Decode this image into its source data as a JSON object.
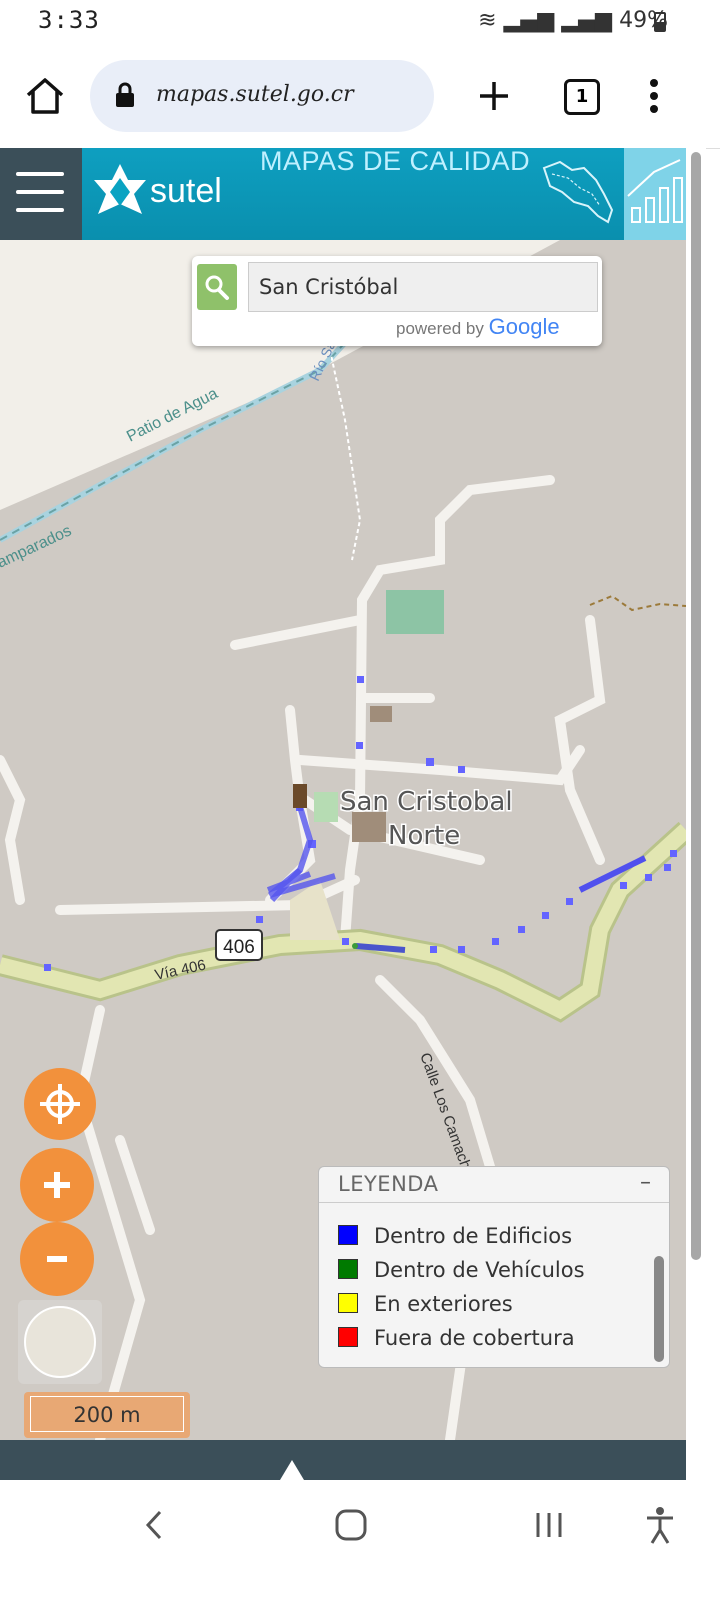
{
  "status_bar": {
    "time": "3:33",
    "battery": "49%"
  },
  "browser": {
    "url": "mapas.sutel.go.cr",
    "tab_count": "1"
  },
  "header": {
    "brand": "sutel",
    "title": "MAPAS DE CALIDAD"
  },
  "search": {
    "value": "San Cristóbal",
    "powered_by": "powered by",
    "google": "Google"
  },
  "map": {
    "labels": {
      "patio": "Patio de Agua",
      "rio": "Río San Cristóbal",
      "amparados": "amparados",
      "place_line1": "San Cristobal",
      "place_line2": "Norte",
      "route_badge": "406",
      "via": "Vía 406",
      "calle": "Calle Los Camacho"
    }
  },
  "scale": {
    "label": "200 m"
  },
  "legend": {
    "title": "LEYENDA",
    "collapse": "–",
    "items": [
      {
        "label": "Dentro de Edificios",
        "color": "#0000ff"
      },
      {
        "label": "Dentro de Vehículos",
        "color": "#007a00"
      },
      {
        "label": "En exteriores",
        "color": "#ffff00"
      },
      {
        "label": "Fuera de cobertura",
        "color": "#ff0000"
      }
    ]
  },
  "colors": {
    "accent": "#f2913c",
    "header": "#0aa3c2",
    "dark": "#3b4f59"
  }
}
